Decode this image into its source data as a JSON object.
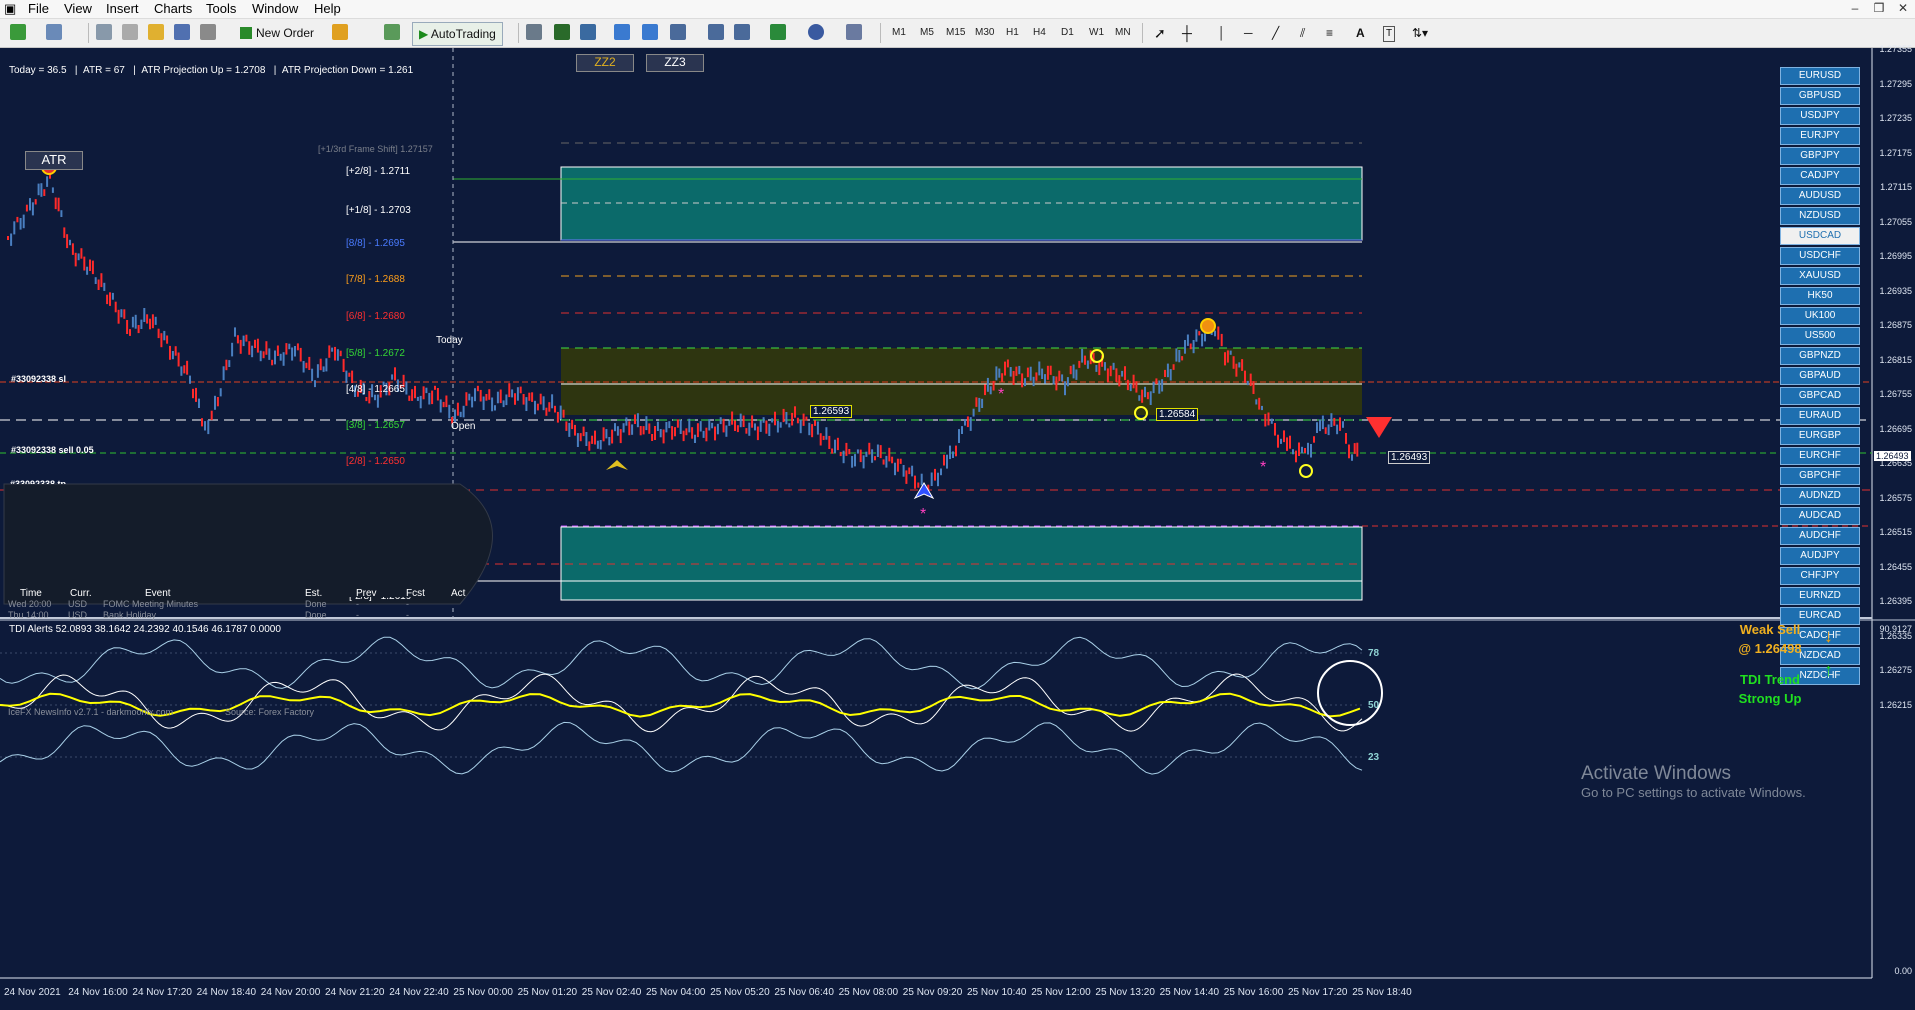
{
  "menu": [
    "File",
    "View",
    "Insert",
    "Charts",
    "Tools",
    "Window",
    "Help"
  ],
  "toolbar": {
    "new_order": "New Order",
    "autotrading": "AutoTrading",
    "timeframes": [
      "M1",
      "M5",
      "M15",
      "M30",
      "H1",
      "H4",
      "D1",
      "W1",
      "MN"
    ]
  },
  "window_controls": [
    "–",
    "❒",
    "✕"
  ],
  "header_text": [
    "Today = 36.5",
    "ATR = 67",
    "ATR Projection Up = 1.2708",
    "ATR Projection Down = 1.261"
  ],
  "buttons": {
    "atr": "ATR",
    "zz2": "ZZ2",
    "zz3": "ZZ3"
  },
  "frame_shift": "[+1/3rd Frame Shift]  1.27157",
  "murrey_levels": [
    {
      "label": "[+2/8] - 1.2711",
      "color": "#ffffff"
    },
    {
      "label": "[+1/8] - 1.2703",
      "color": "#ffffff"
    },
    {
      "label": "[8/8] - 1.2695",
      "color": "#4a7bff"
    },
    {
      "label": "[7/8] - 1.2688",
      "color": "#ff9f1a"
    },
    {
      "label": "[6/8] - 1.2680",
      "color": "#ff3030"
    },
    {
      "label": "[5/8] - 1.2672",
      "color": "#35d635"
    },
    {
      "label": "[4/8] - 1.2665",
      "color": "#ffffff"
    },
    {
      "label": "[3/8] - 1.2657",
      "color": "#35d635"
    },
    {
      "label": "[2/8] - 1.2650",
      "color": "#ff3030"
    },
    {
      "label": "[-2/8] - 1.2619",
      "color": "#ffffff"
    }
  ],
  "labels": {
    "today": "Today",
    "open": "Open",
    "order_sl": "#33092338 sl",
    "order_sell": "#33092338 sell 0.05",
    "order_tp": "#33092338 tp",
    "price_tags": [
      "1.26593",
      "1.26584",
      "1.26493"
    ]
  },
  "news": {
    "headers": [
      "Time",
      "Curr.",
      "Event",
      "Est.",
      "Prev",
      "Fcst",
      "Act"
    ],
    "rows": [
      [
        "Wed 20:00",
        "USD",
        "FOMC Meeting Minutes",
        "Done",
        "-",
        "-"
      ],
      [
        "Thu 14:00",
        "USD",
        "Bank Holiday",
        "Done",
        "-",
        "-"
      ]
    ],
    "footer": [
      "IceFX NewsInfo v2.7.1 - darkmoonfx.com",
      "Source: Forex Factory"
    ]
  },
  "symbols": [
    "EURUSD",
    "GBPUSD",
    "USDJPY",
    "EURJPY",
    "GBPJPY",
    "CADJPY",
    "AUDUSD",
    "NZDUSD",
    "USDCAD",
    "USDCHF",
    "XAUUSD",
    "HK50",
    "UK100",
    "US500",
    "GBPNZD",
    "GBPAUD",
    "GBPCAD",
    "EURAUD",
    "EURGBP",
    "EURCHF",
    "GBPCHF",
    "AUDNZD",
    "AUDCAD",
    "AUDCHF",
    "AUDJPY",
    "CHFJPY",
    "EURNZD",
    "EURCAD",
    "CADCHF",
    "NZDCAD",
    "NZDCHF"
  ],
  "active_symbol": "USDCAD",
  "price_axis": [
    "1.27355",
    "1.27295",
    "1.27235",
    "1.27175",
    "1.27115",
    "1.27055",
    "1.26995",
    "1.26935",
    "1.26875",
    "1.26815",
    "1.26755",
    "1.26695",
    "1.26635",
    "1.26575",
    "1.26515",
    "1.26455",
    "1.26395",
    "1.26335",
    "1.26275",
    "1.26215"
  ],
  "current_price": "1.26493",
  "tdi": {
    "title": "TDI Alerts  52.0893 38.1642 24.2392 40.1546 46.1787 0.0000",
    "levels": [
      "78",
      "50",
      "23"
    ],
    "axis": [
      "90.9127",
      "0.00"
    ],
    "signal1": "Weak Sell",
    "signal1_price": "@ 1.26498",
    "signal2a": "TDI Trend",
    "signal2b": "Strong Up"
  },
  "time_axis": [
    "24 Nov 2021",
    "24 Nov 16:00",
    "24 Nov 17:20",
    "24 Nov 18:40",
    "24 Nov 20:00",
    "24 Nov 21:20",
    "24 Nov 22:40",
    "25 Nov 00:00",
    "25 Nov 01:20",
    "25 Nov 02:40",
    "25 Nov 04:00",
    "25 Nov 05:20",
    "25 Nov 06:40",
    "25 Nov 08:00",
    "25 Nov 09:20",
    "25 Nov 10:40",
    "25 Nov 12:00",
    "25 Nov 13:20",
    "25 Nov 14:40",
    "25 Nov 16:00",
    "25 Nov 17:20",
    "25 Nov 18:40"
  ],
  "watermark": {
    "line1": "Activate Windows",
    "line2": "Go to PC settings to activate Windows."
  },
  "colors": {
    "background": "#0d1a3a",
    "bull": "#4a7fc0",
    "bear": "#ff2a2a",
    "zone_teal": "#0b6a6a",
    "zone_olive": "#2e3510",
    "tdi_yellow": "#ffff00"
  }
}
